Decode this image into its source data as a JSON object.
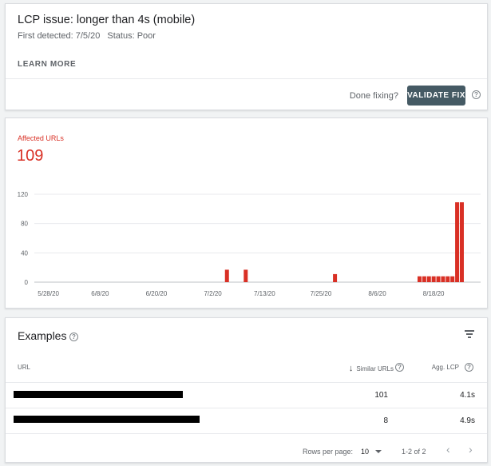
{
  "issue": {
    "title": "LCP issue: longer than 4s (mobile)",
    "first_detected": "First detected: 7/5/20",
    "status": "Status: Poor",
    "learn_more": "LEARN MORE",
    "done_fixing": "Done fixing?",
    "validate_fix": "VALIDATE FIX",
    "help_icon": "help-circle-icon"
  },
  "affected": {
    "label": "Affected URLs",
    "count": "109",
    "color": "#d93025"
  },
  "chart_data": {
    "type": "bar",
    "color": "#d93025",
    "grid": true,
    "ylim": [
      0,
      120
    ],
    "yticks": [
      0,
      40,
      80,
      120
    ],
    "x_tick_labels": [
      "5/28/20",
      "6/8/20",
      "6/20/20",
      "7/2/20",
      "7/13/20",
      "7/25/20",
      "8/6/20",
      "8/18/20"
    ],
    "x_tick_days": [
      0,
      11,
      23,
      35,
      46,
      58,
      70,
      82
    ],
    "day_range": [
      -3,
      92
    ],
    "bars": [
      {
        "day": 38,
        "value": 17
      },
      {
        "day": 42,
        "value": 17
      },
      {
        "day": 61,
        "value": 11
      },
      {
        "day": 79,
        "value": 8
      },
      {
        "day": 80,
        "value": 8
      },
      {
        "day": 81,
        "value": 8
      },
      {
        "day": 82,
        "value": 8
      },
      {
        "day": 83,
        "value": 8
      },
      {
        "day": 84,
        "value": 8
      },
      {
        "day": 85,
        "value": 8
      },
      {
        "day": 86,
        "value": 8
      },
      {
        "day": 87,
        "value": 109
      },
      {
        "day": 88,
        "value": 109
      }
    ]
  },
  "examples": {
    "title": "Examples",
    "columns": {
      "url": "URL",
      "similar": "Similar URLs",
      "agg": "Agg. LCP"
    },
    "rows": [
      {
        "url": "",
        "similar": "101",
        "agg": "4.1s"
      },
      {
        "url": "",
        "similar": "8",
        "agg": "4.9s"
      }
    ],
    "footer": {
      "rows_per_page_label": "Rows per page:",
      "rows_per_page_value": "10",
      "range": "1-2 of 2",
      "prev": "‹",
      "next": "›"
    },
    "filter_icon": "filter-icon",
    "sort_icon": "arrow-down-icon"
  }
}
